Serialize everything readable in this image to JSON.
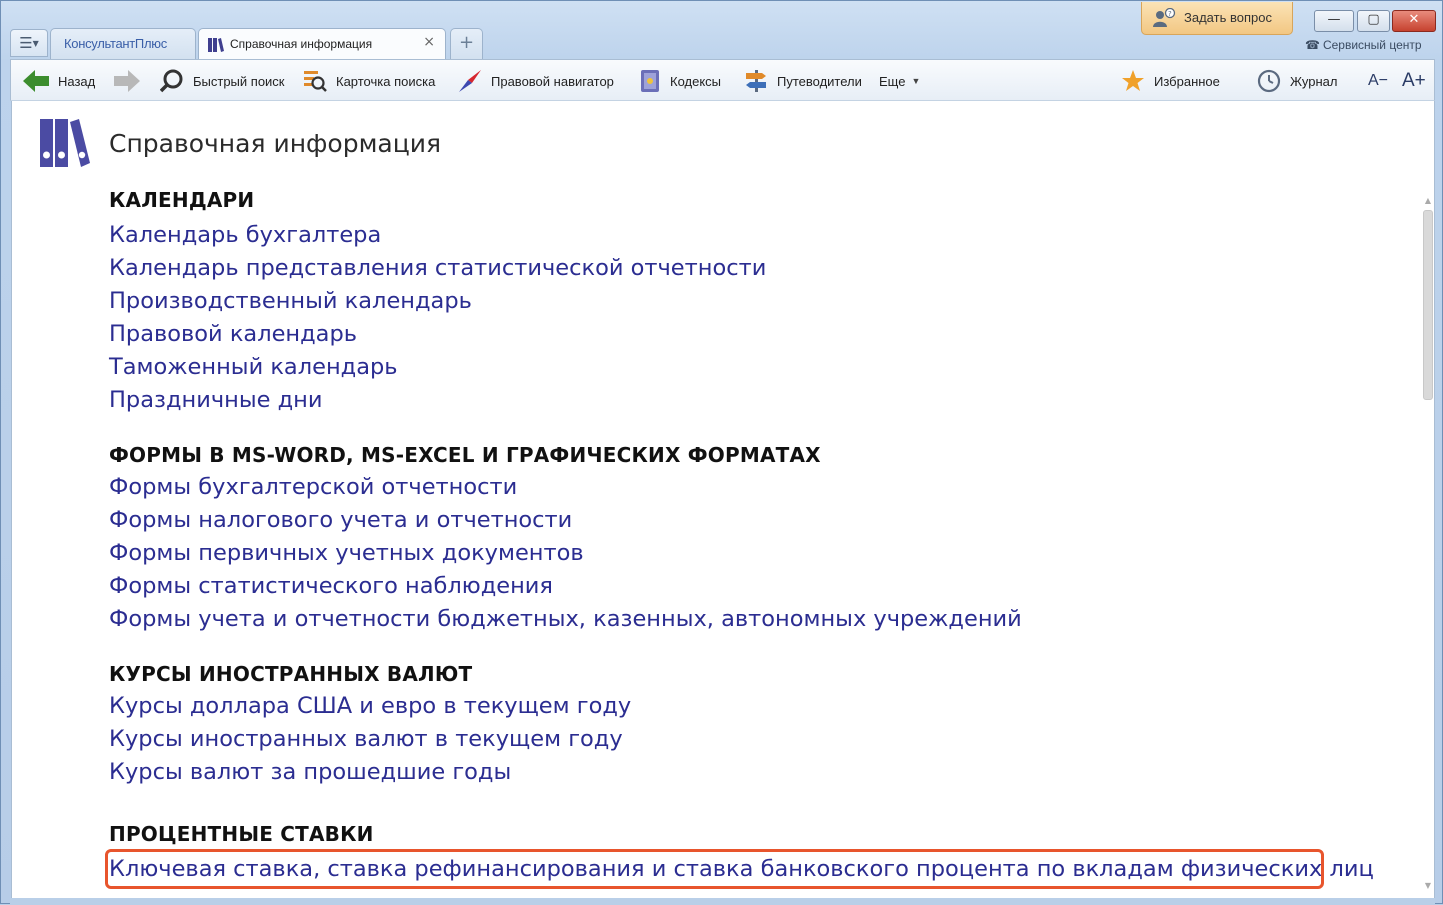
{
  "window": {
    "tab_logo": "КонсультантПлюс",
    "active_tab": "Справочная информация",
    "ask_question": "Задать вопрос",
    "service_center": "Сервисный центр",
    "controls": {
      "minimize": "—",
      "maximize": "▢",
      "close": "✕"
    }
  },
  "toolbar": {
    "back": "Назад",
    "quick_search": "Быстрый поиск",
    "search_card": "Карточка поиска",
    "legal_navigator": "Правовой навигатор",
    "codes": "Кодексы",
    "guides": "Путеводители",
    "more": "Еще",
    "favorites": "Избранное",
    "journal": "Журнал",
    "font_smaller": "A−",
    "font_larger": "A+"
  },
  "page": {
    "title": "Справочная информация",
    "sections": [
      {
        "heading": "КАЛЕНДАРИ",
        "links": [
          "Календарь бухгалтера",
          "Календарь представления статистической отчетности",
          "Производственный календарь",
          "Правовой календарь",
          "Таможенный календарь",
          "Праздничные дни"
        ]
      },
      {
        "heading": "ФОРМЫ В MS-WORD, MS-EXCEL И ГРАФИЧЕСКИХ ФОРМАТАХ",
        "links": [
          "Формы бухгалтерской отчетности",
          "Формы налогового учета и отчетности",
          "Формы первичных учетных документов",
          "Формы статистического наблюдения",
          "Формы учета и отчетности бюджетных, казенных, автономных учреждений"
        ]
      },
      {
        "heading": "КУРСЫ ИНОСТРАННЫХ ВАЛЮТ",
        "links": [
          "Курсы доллара США и евро в текущем году",
          "Курсы иностранных валют в текущем году",
          "Курсы валют за прошедшие годы"
        ]
      },
      {
        "heading": "ПРОЦЕНТНЫЕ СТАВКИ",
        "links": [
          "Ключевая ставка, ставка рефинансирования и ставка банковского процента по вкладам физических лиц"
        ]
      }
    ]
  },
  "colors": {
    "link": "#2b2d91",
    "highlight": "#e8552d",
    "ask_bg": "#f2c783",
    "close_btn": "#c6422f"
  }
}
